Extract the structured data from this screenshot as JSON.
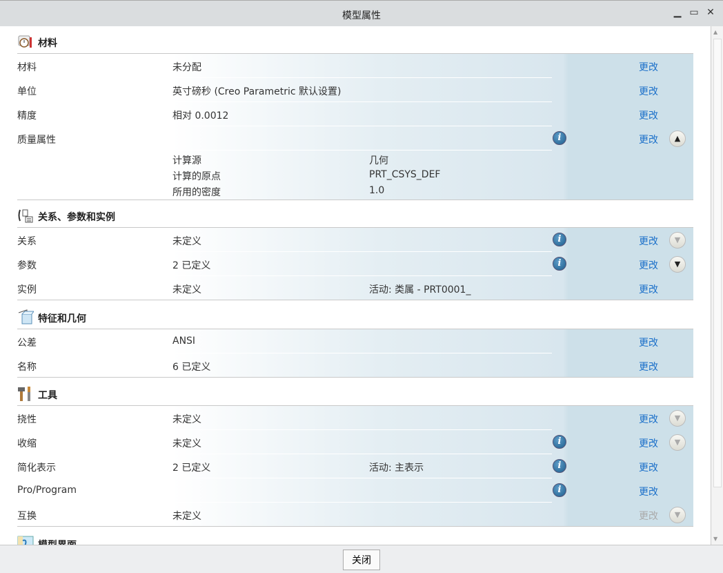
{
  "window": {
    "title": "模型属性",
    "minimize": "▁",
    "maximize": "▭",
    "close": "✕"
  },
  "footer": {
    "close_label": "关闭"
  },
  "sections": [
    {
      "title": "材料",
      "icon": "material-icon",
      "rows": [
        {
          "label": "材料",
          "value": "未分配",
          "change": "更改"
        },
        {
          "label": "单位",
          "value": "英寸磅秒 (Creo Parametric 默认设置)",
          "change": "更改"
        },
        {
          "label": "精度",
          "value": "相对 0.0012",
          "change": "更改"
        },
        {
          "label": "质量属性",
          "value": "",
          "info": true,
          "change": "更改",
          "chevron": "up",
          "details": [
            {
              "label": "计算源",
              "value": "几何"
            },
            {
              "label": "计算的原点",
              "value": "PRT_CSYS_DEF"
            },
            {
              "label": "所用的密度",
              "value": "1.0"
            }
          ]
        }
      ]
    },
    {
      "title": "关系、参数和实例",
      "icon": "relations-icon",
      "rows": [
        {
          "label": "关系",
          "value": "未定义",
          "info": true,
          "change": "更改",
          "chevron": "down-dim"
        },
        {
          "label": "参数",
          "value": "2 已定义",
          "info": true,
          "change": "更改",
          "chevron": "down"
        },
        {
          "label": "实例",
          "value": "未定义",
          "value2": "活动: 类属 - PRT0001_",
          "change": "更改"
        }
      ]
    },
    {
      "title": "特征和几何",
      "icon": "feature-geometry-icon",
      "rows": [
        {
          "label": "公差",
          "value": "ANSI",
          "change": "更改"
        },
        {
          "label": "名称",
          "value": "6 已定义",
          "change": "更改"
        }
      ]
    },
    {
      "title": "工具",
      "icon": "tools-icon",
      "rows": [
        {
          "label": "挠性",
          "value": "未定义",
          "change": "更改",
          "chevron": "down-dim"
        },
        {
          "label": "收缩",
          "value": "未定义",
          "info": true,
          "change": "更改",
          "chevron": "down-dim"
        },
        {
          "label": "简化表示",
          "value": "2 已定义",
          "value2": "活动: 主表示",
          "info": true,
          "change": "更改"
        },
        {
          "label": "Pro/Program",
          "value": "",
          "info": true,
          "change": "更改"
        },
        {
          "label": "互换",
          "value": "未定义",
          "change": "更改",
          "change_disabled": true,
          "chevron": "down-dim"
        }
      ]
    },
    {
      "title": "模型界面",
      "icon": "model-interface-icon",
      "rows": []
    }
  ]
}
